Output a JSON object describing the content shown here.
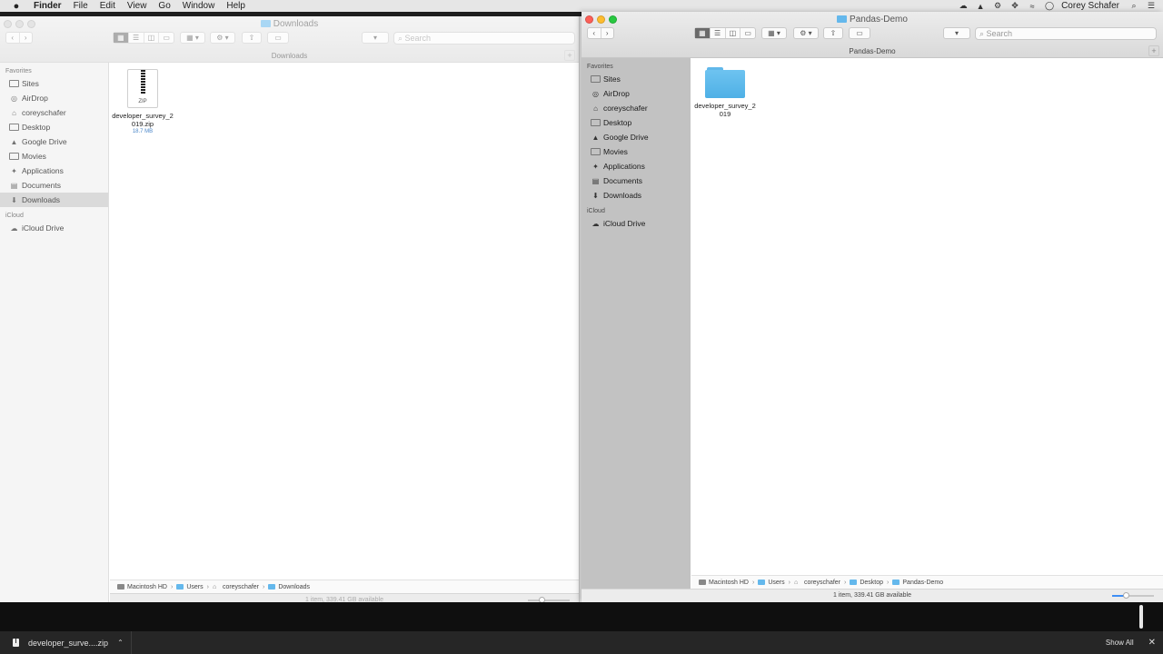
{
  "menubar": {
    "apple": "",
    "items": [
      "Finder",
      "File",
      "Edit",
      "View",
      "Go",
      "Window",
      "Help"
    ],
    "user": "Corey Schafer"
  },
  "left_window": {
    "title": "Downloads",
    "path_title": "Downloads",
    "search_placeholder": "Search",
    "sidebar": {
      "favorites_label": "Favorites",
      "favorites": [
        {
          "label": "Sites",
          "icon": "folder-icon"
        },
        {
          "label": "AirDrop",
          "icon": "airdrop-icon"
        },
        {
          "label": "coreyschafer",
          "icon": "home-icon"
        },
        {
          "label": "Desktop",
          "icon": "desktop-icon"
        },
        {
          "label": "Google Drive",
          "icon": "google-drive-icon"
        },
        {
          "label": "Movies",
          "icon": "movies-icon"
        },
        {
          "label": "Applications",
          "icon": "applications-icon"
        },
        {
          "label": "Documents",
          "icon": "documents-icon"
        },
        {
          "label": "Downloads",
          "icon": "downloads-icon",
          "selected": true
        }
      ],
      "icloud_label": "iCloud",
      "icloud": [
        {
          "label": "iCloud Drive",
          "icon": "cloud-icon"
        }
      ]
    },
    "files": [
      {
        "name": "developer_survey_2019.zip",
        "size": "18.7 MB",
        "type": "zip",
        "badge": "ZIP"
      }
    ],
    "breadcrumb": [
      "Macintosh HD",
      "Users",
      "coreyschafer",
      "Downloads"
    ],
    "status": "1 item, 339.41 GB available"
  },
  "right_window": {
    "title": "Pandas-Demo",
    "path_title": "Pandas-Demo",
    "search_placeholder": "Search",
    "sidebar": {
      "favorites_label": "Favorites",
      "favorites": [
        {
          "label": "Sites",
          "icon": "folder-icon"
        },
        {
          "label": "AirDrop",
          "icon": "airdrop-icon"
        },
        {
          "label": "coreyschafer",
          "icon": "home-icon"
        },
        {
          "label": "Desktop",
          "icon": "desktop-icon"
        },
        {
          "label": "Google Drive",
          "icon": "google-drive-icon"
        },
        {
          "label": "Movies",
          "icon": "movies-icon"
        },
        {
          "label": "Applications",
          "icon": "applications-icon"
        },
        {
          "label": "Documents",
          "icon": "documents-icon"
        },
        {
          "label": "Downloads",
          "icon": "downloads-icon"
        }
      ],
      "icloud_label": "iCloud",
      "icloud": [
        {
          "label": "iCloud Drive",
          "icon": "cloud-icon"
        }
      ]
    },
    "files": [
      {
        "name": "developer_survey_2019",
        "type": "folder"
      }
    ],
    "breadcrumb": [
      "Macintosh HD",
      "Users",
      "coreyschafer",
      "Desktop",
      "Pandas-Demo"
    ],
    "status": "1 item, 339.41 GB available"
  },
  "download_shelf": {
    "item_label": "developer_surve....zip",
    "show_all": "Show All",
    "close": "✕"
  },
  "colors": {
    "folder_blue": "#64b8ec",
    "traffic_red": "#fc5f57",
    "traffic_yellow": "#fdbc2e",
    "traffic_green": "#28c840"
  }
}
